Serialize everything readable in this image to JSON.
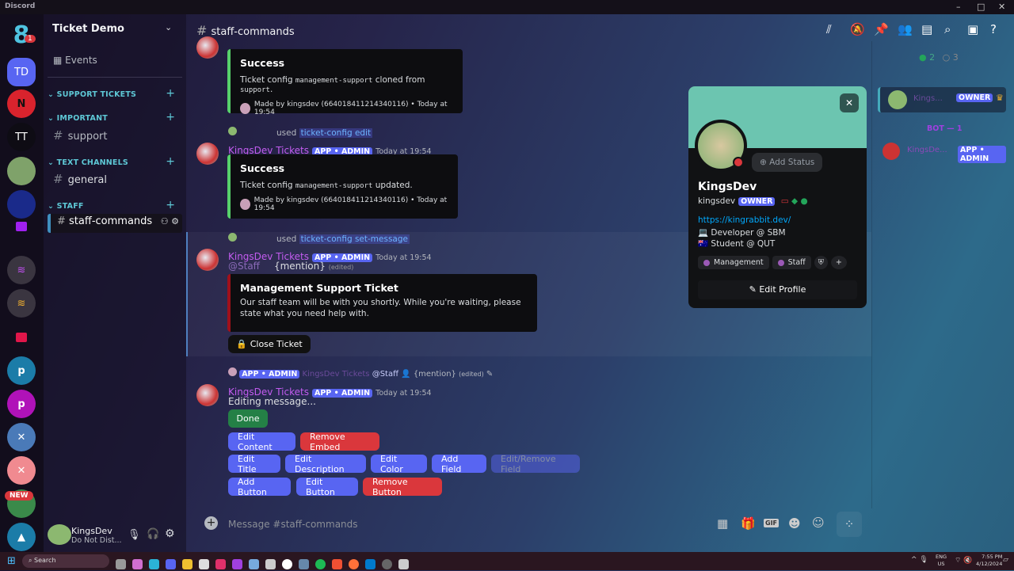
{
  "window": {
    "title": "Discord"
  },
  "rail": {
    "home_badge": "1",
    "servers": [
      {
        "label": "TD"
      },
      {
        "label": "N"
      },
      {
        "label": "TT"
      }
    ],
    "new_badge": "NEW"
  },
  "sidebar": {
    "server_name": "Ticket Demo",
    "events": "Events",
    "categories": [
      {
        "name": "SUPPORT TICKETS"
      },
      {
        "name": "IMPORTANT"
      },
      {
        "name": "TEXT CHANNELS"
      },
      {
        "name": "STAFF"
      }
    ],
    "channels": {
      "support": "support",
      "general": "general",
      "staff": "staff-commands"
    }
  },
  "user": {
    "name": "KingsDev",
    "status": "Do Not Dist..."
  },
  "header": {
    "channel": "staff-commands"
  },
  "messages": [
    {
      "embed_title": "Success",
      "embed_pre": "Ticket config ",
      "code1": "management-support",
      "embed_mid": " cloned from ",
      "code2": "support",
      "embed_post": ".",
      "footer": "Made by kingsdev (664018411214340116) • Today at 19:54"
    },
    {
      "used": "used",
      "command": "ticket-config edit",
      "author": "KingsDev Tickets",
      "tag": "APP • ADMIN",
      "time": "Today at 19:54",
      "embed_title": "Success",
      "embed_pre": "Ticket config ",
      "code1": "management-support",
      "embed_post": " updated.",
      "footer": "Made by kingsdev (664018411214340116) • Today at 19:54"
    },
    {
      "used": "used",
      "command": "ticket-config set-message",
      "author": "KingsDev Tickets",
      "tag": "APP • ADMIN",
      "time": "Today at 19:54",
      "mention": "@Staff",
      "content": "{mention}",
      "edited": "(edited)",
      "embed_title": "Management Support Ticket",
      "embed_desc": "Our staff team will be with you shortly. While you're waiting, please state what you need help with.",
      "button": "Close Ticket"
    },
    {
      "reply_tag": "APP • ADMIN",
      "reply_author": "KingsDev Tickets",
      "reply_mention": "@Staff",
      "reply_content": "{mention}",
      "reply_edited": "(edited)",
      "author": "KingsDev Tickets",
      "tag": "APP • ADMIN",
      "time": "Today at 19:54",
      "content": "Editing message...",
      "buttons": {
        "done": "Done",
        "edit_content": "Edit Content",
        "remove_embed": "Remove Embed",
        "edit_title": "Edit Title",
        "edit_description": "Edit Description",
        "edit_color": "Edit Color",
        "add_field": "Add Field",
        "edit_remove_field": "Edit/Remove Field",
        "add_button": "Add Button",
        "edit_button": "Edit Button",
        "remove_button": "Remove Button"
      }
    }
  ],
  "composer": {
    "placeholder": "Message #staff-commands"
  },
  "members": {
    "online": "2",
    "offline": "3",
    "owner_tag": "OWNER",
    "owner_name": "Kings...",
    "bot_header": "BOT — 1",
    "bot_name": "KingsDe...",
    "bot_tag": "APP • ADMIN"
  },
  "profile": {
    "add_status": "Add Status",
    "display_name": "KingsDev",
    "username": "kingsdev",
    "tag": "OWNER",
    "link": "https://kingrabbit.dev/",
    "bio1": "💻 Developer @ SBM",
    "bio2": "🇦🇺 Student @ QUT",
    "roles": [
      "Management",
      "Staff"
    ],
    "edit": "Edit Profile",
    "banner_color": "#6cc5b0"
  },
  "taskbar": {
    "search": "Search",
    "lang1": "ENG",
    "lang2": "US",
    "time": "7:55 PM",
    "date": "4/12/2024"
  },
  "colors": {
    "accent": "#5865f2",
    "danger": "#da373c",
    "success": "#248046",
    "role_name": "#c35cf0"
  }
}
